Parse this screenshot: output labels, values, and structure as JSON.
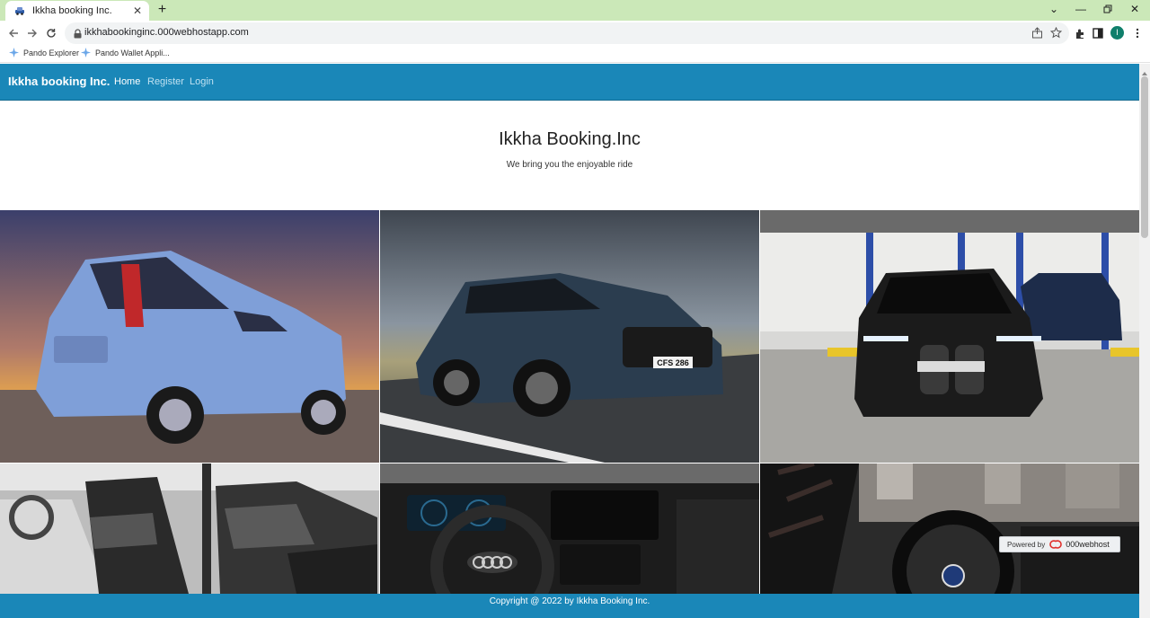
{
  "browser": {
    "tab_title": "Ikkha booking Inc.",
    "url": "ikkhabookinginc.000webhostapp.com",
    "profile_initial": "I",
    "bookmarks": [
      "Pando Explorer",
      "Pando Wallet Appli..."
    ]
  },
  "site": {
    "brand": "Ikkha booking Inc.",
    "nav": [
      "Home",
      "Register",
      "Login"
    ],
    "hero_title": "Ikkha Booking.Inc",
    "hero_subtitle": "We bring you the enjoyable ride",
    "gallery": [
      {
        "name": "blue-hatchback-photo",
        "colors": {
          "bg": "#5a5a8a",
          "car": "#7fa0d6"
        }
      },
      {
        "name": "dark-suv-road-photo",
        "colors": {
          "bg": "#5b6570",
          "car": "#2c3e50"
        },
        "plate": "CFS 286"
      },
      {
        "name": "black-ev-garage-photo",
        "colors": {
          "bg": "#d9d9d9",
          "car": "#1b1b1b"
        }
      },
      {
        "name": "hatchback-interior-photo",
        "colors": {
          "bg": "#b9b9b9",
          "car": "#333333"
        }
      },
      {
        "name": "luxury-dashboard-photo",
        "colors": {
          "bg": "#1e1e1e",
          "car": "#3a3a3a"
        }
      },
      {
        "name": "steering-wheel-closeup-photo",
        "colors": {
          "bg": "#2a2a2a",
          "car": "#111111"
        }
      }
    ],
    "footer": "Copyright @ 2022 by Ikkha Booking Inc.",
    "powered_by": "Powered by",
    "host_brand": "000webhost"
  },
  "colors": {
    "navbar": "#1a87b8",
    "tabstrip": "#cbe8b8"
  }
}
